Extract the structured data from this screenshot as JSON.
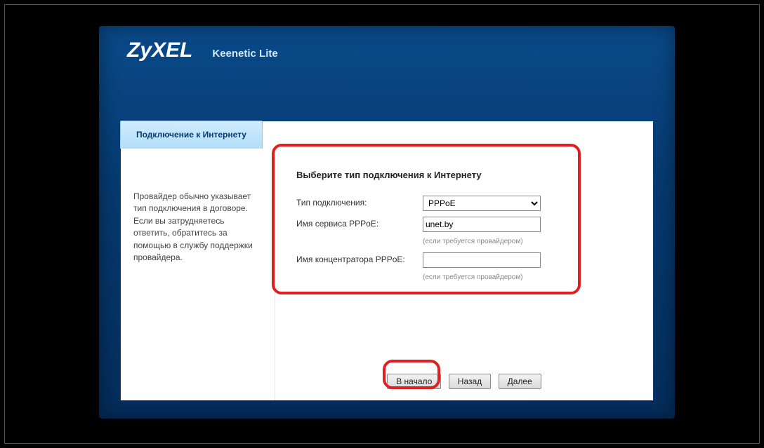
{
  "brand": "ZyXEL",
  "device": "Keenetic Lite",
  "tab_label": "Подключение к Интернету",
  "sidebar_text": "Провайдер обычно указывает тип подключения в договоре. Если вы затрудняетесь ответить, обратитесь за помощью в службу поддержки провайдера.",
  "section_title": "Выберите тип подключения к Интернету",
  "fields": {
    "conn_type_label": "Тип подключения:",
    "conn_type_value": "PPPoE",
    "service_label": "Имя сервиса PPPoE:",
    "service_value": "unet.by",
    "service_hint": "(если требуется провайдером)",
    "concentrator_label": "Имя концентратора PPPoE:",
    "concentrator_value": "",
    "concentrator_hint": "(если требуется провайдером)"
  },
  "buttons": {
    "home": "В начало",
    "back": "Назад",
    "next": "Далее"
  }
}
